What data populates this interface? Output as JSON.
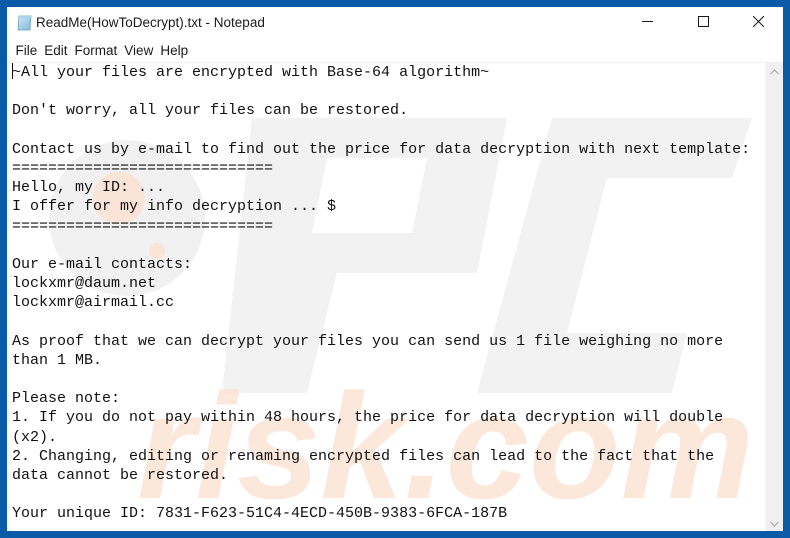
{
  "window": {
    "title": "ReadMe(HowToDecrypt).txt - Notepad",
    "app_icon": "notepad-icon",
    "controls": {
      "minimize": "minimize-icon",
      "maximize": "maximize-icon",
      "close": "close-icon"
    }
  },
  "menubar": {
    "items": [
      {
        "label": "File"
      },
      {
        "label": "Edit"
      },
      {
        "label": "Format"
      },
      {
        "label": "View"
      },
      {
        "label": "Help"
      }
    ]
  },
  "editor": {
    "lines": [
      "~All your files are encrypted with Base-64 algorithm~",
      "",
      "Don't worry, all your files can be restored.",
      "",
      "Contact us by e-mail to find out the price for data decryption with next template:",
      "=============================",
      "Hello, my ID: ...",
      "I offer for my info decryption ... $",
      "=============================",
      "",
      "Our e-mail contacts:",
      "lockxmr@daum.net",
      "lockxmr@airmail.cc",
      "",
      "As proof that we can decrypt your files you can send us 1 file weighing no more",
      "than 1 MB.",
      "",
      "Please note:",
      "1. If you do not pay within 48 hours, the price for data decryption will double",
      "(x2).",
      "2. Changing, editing or renaming encrypted files can lead to the fact that the",
      "data cannot be restored.",
      "",
      "Your unique ID: 7831-F623-51C4-4ECD-450B-9383-6FCA-187B"
    ]
  },
  "watermark": {
    "text_top": "PC",
    "text_bottom": "risk.com",
    "colors": {
      "gray": "#e6e6e6",
      "orange": "#fbe3d3"
    }
  },
  "colors": {
    "window_border": "#0a5aa8",
    "background": "#ffffff",
    "text": "#111111",
    "scrollbar_track": "#f0f0f0"
  }
}
